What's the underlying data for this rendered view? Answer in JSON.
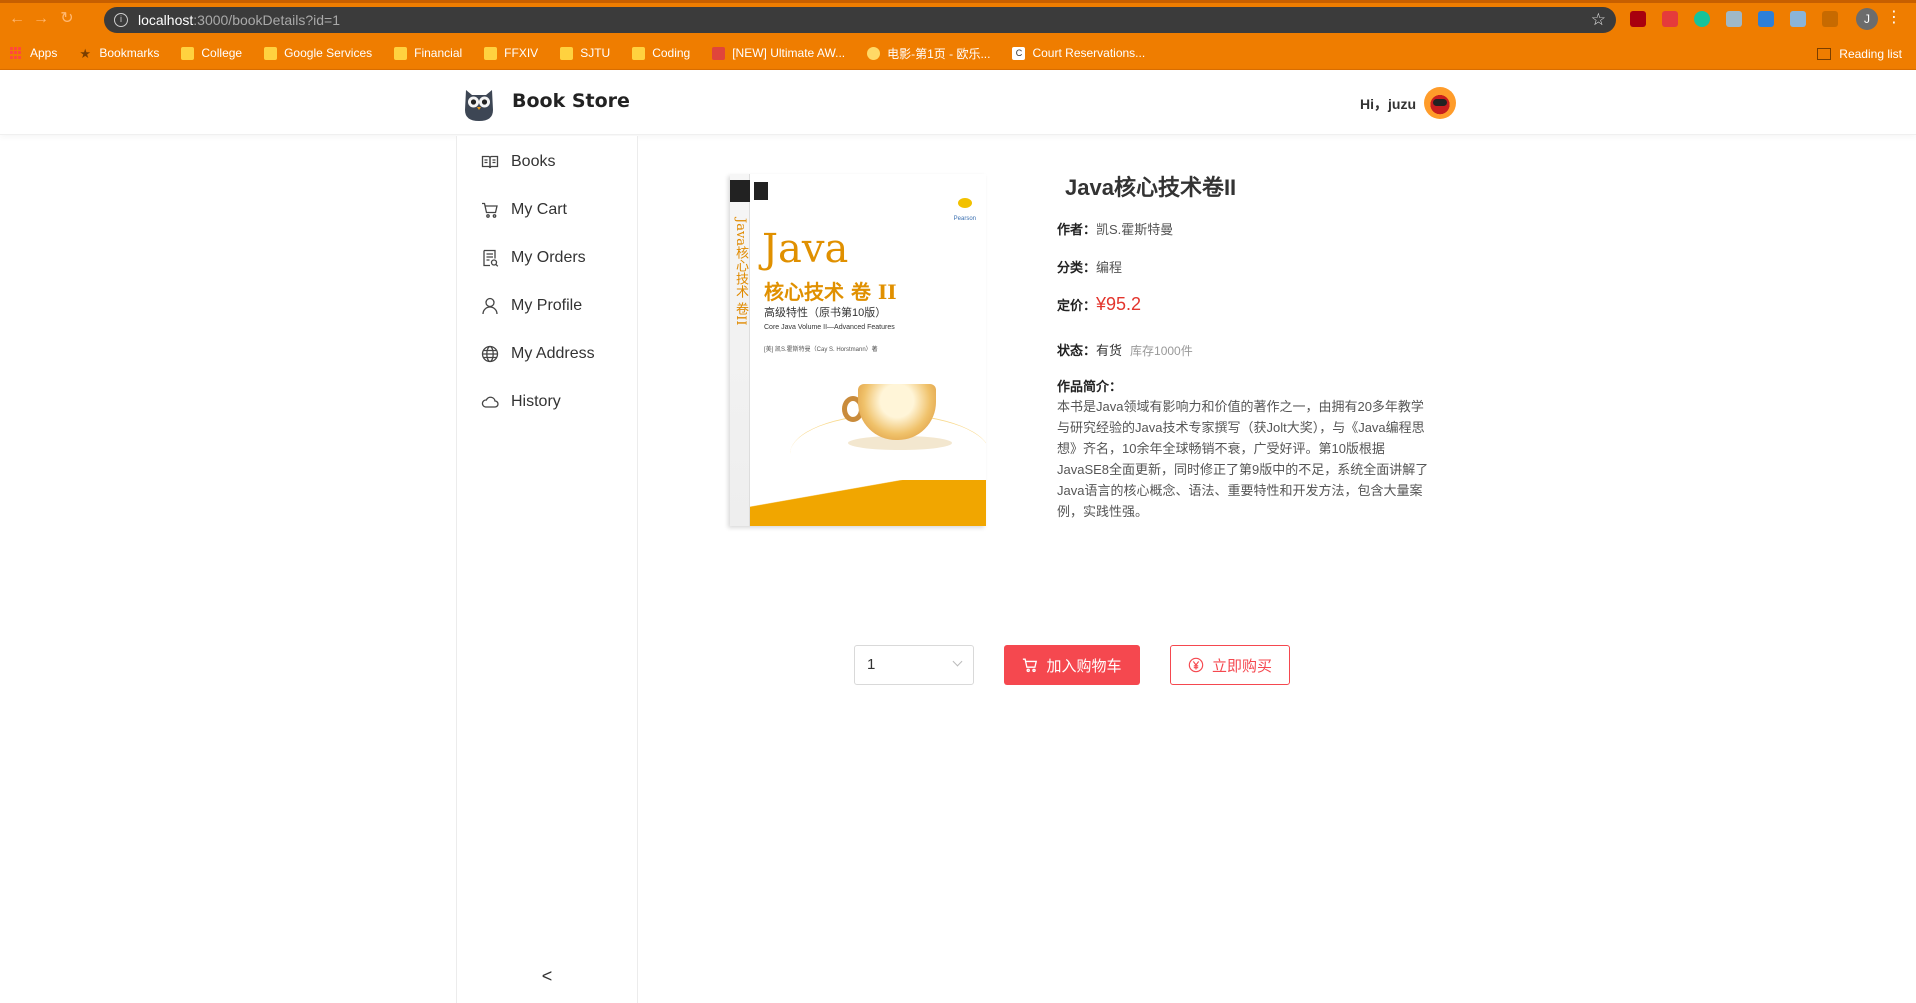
{
  "browser": {
    "url_host": "localhost",
    "url_path": ":3000/bookDetails?id=1",
    "profile_initial": "J",
    "bookmarks": [
      {
        "label": "Apps",
        "icon": "apps-icon"
      },
      {
        "label": "Bookmarks",
        "icon": "star-icon"
      },
      {
        "label": "College",
        "icon": "folder-icon"
      },
      {
        "label": "Google Services",
        "icon": "folder-icon"
      },
      {
        "label": "Financial",
        "icon": "folder-icon"
      },
      {
        "label": "FFXIV",
        "icon": "folder-icon"
      },
      {
        "label": "SJTU",
        "icon": "folder-icon"
      },
      {
        "label": "Coding",
        "icon": "folder-icon"
      },
      {
        "label": "[NEW] Ultimate AW...",
        "icon": "site-icon"
      },
      {
        "label": "电影-第1页 - 欧乐...",
        "icon": "site-icon"
      },
      {
        "label": "Court Reservations...",
        "icon": "site-icon"
      }
    ],
    "reading_list": "Reading list"
  },
  "header": {
    "brand": "Book Store",
    "greeting": "Hi，juzu"
  },
  "sidebar": {
    "items": [
      {
        "label": "Books",
        "icon": "book-icon"
      },
      {
        "label": "My Cart",
        "icon": "cart-icon"
      },
      {
        "label": "My Orders",
        "icon": "orders-icon"
      },
      {
        "label": "My Profile",
        "icon": "user-icon"
      },
      {
        "label": "My Address",
        "icon": "globe-icon"
      },
      {
        "label": "History",
        "icon": "cloud-icon"
      }
    ],
    "collapse_glyph": "<"
  },
  "book": {
    "title": "Java核心技术卷II",
    "author_label": "作者：",
    "author": "凯S.霍斯特曼",
    "category_label": "分类：",
    "category": "编程",
    "price_label": "定价：",
    "price": "¥95.2",
    "status_label": "状态：",
    "status": "有货",
    "stock": "库存1000件",
    "intro_label": "作品简介：",
    "intro": "本书是Java领域有影响力和价值的著作之一，由拥有20多年教学与研究经验的Java技术专家撰写（获Jolt大奖），与《Java编程思想》齐名，10余年全球畅销不衰，广受好评。第10版根据JavaSE8全面更新，同时修正了第9版中的不足，系统全面讲解了Java语言的核心概念、语法、重要特性和开发方法，包含大量案例，实践性强。",
    "cover": {
      "spine_text": "Java核心技术 卷II",
      "java": "Java",
      "zh_title": "核心技术 卷 II",
      "subtitle": "高级特性（原书第10版）",
      "en_title": "Core Java Volume II—Advanced Features",
      "authors": "[美] 凯S.霍斯特曼（Cay S. Horstmann）著",
      "publisher": "Pearson"
    }
  },
  "actions": {
    "quantity": "1",
    "add_to_cart": "加入购物车",
    "buy_now": "立即购买"
  },
  "colors": {
    "chrome": "#ef7d00",
    "accent": "#f5484f"
  }
}
